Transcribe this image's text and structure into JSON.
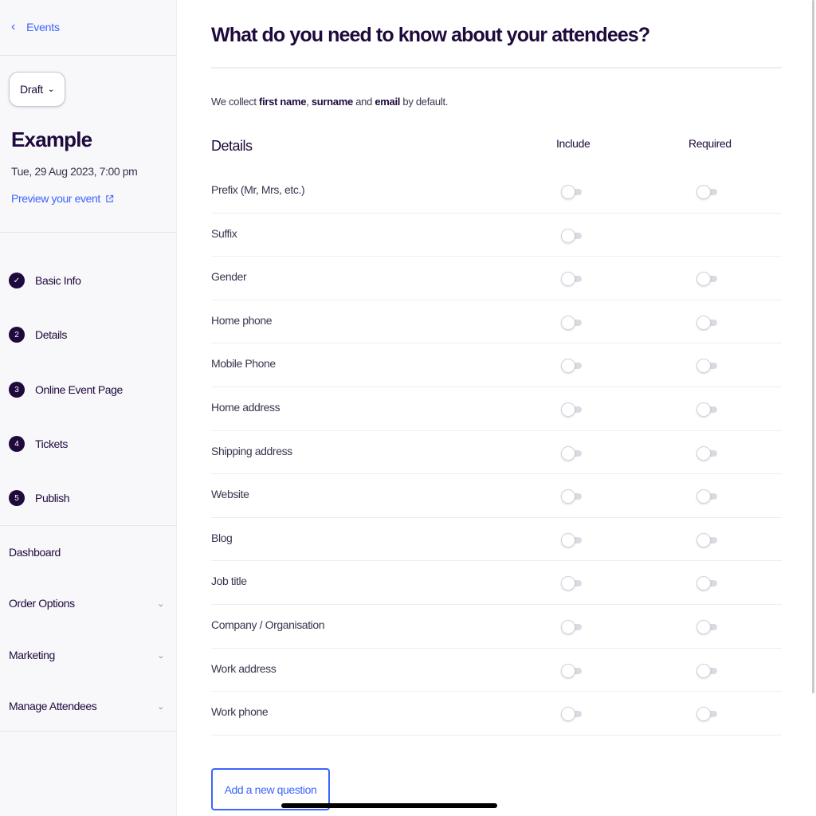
{
  "sidebar": {
    "back_label": "Events",
    "status": "Draft",
    "event_name": "Example",
    "event_date": "Tue, 29 Aug 2023, 7:00 pm",
    "preview_label": "Preview your event",
    "steps": [
      {
        "num": "✓",
        "label": "Basic Info",
        "state": "complete"
      },
      {
        "num": "2",
        "label": "Details",
        "state": "pending"
      },
      {
        "num": "3",
        "label": "Online Event Page",
        "state": "pending"
      },
      {
        "num": "4",
        "label": "Tickets",
        "state": "pending"
      },
      {
        "num": "5",
        "label": "Publish",
        "state": "pending"
      }
    ],
    "nav": [
      {
        "label": "Dashboard",
        "expandable": false
      },
      {
        "label": "Order Options",
        "expandable": true
      },
      {
        "label": "Marketing",
        "expandable": true
      },
      {
        "label": "Manage Attendees",
        "expandable": true
      }
    ]
  },
  "main": {
    "title": "What do you need to know about your attendees?",
    "intro": {
      "prefix": "We collect ",
      "first": "first name",
      "sep": ", ",
      "second": "surname",
      "mid": " and ",
      "third": "email",
      "suffix": " by default."
    },
    "details_header": "Details",
    "include_header": "Include",
    "required_header": "Required",
    "rows": [
      {
        "label": "Prefix (Mr, Mrs, etc.)",
        "include": false,
        "required": false,
        "has_required": true
      },
      {
        "label": "Suffix",
        "include": false,
        "required": false,
        "has_required": false
      },
      {
        "label": "Gender",
        "include": false,
        "required": false,
        "has_required": true
      },
      {
        "label": "Home phone",
        "include": false,
        "required": false,
        "has_required": true
      },
      {
        "label": "Mobile Phone",
        "include": false,
        "required": false,
        "has_required": true
      },
      {
        "label": "Home address",
        "include": false,
        "required": false,
        "has_required": true
      },
      {
        "label": "Shipping address",
        "include": false,
        "required": false,
        "has_required": true
      },
      {
        "label": "Website",
        "include": false,
        "required": false,
        "has_required": true
      },
      {
        "label": "Blog",
        "include": false,
        "required": false,
        "has_required": true
      },
      {
        "label": "Job title",
        "include": false,
        "required": false,
        "has_required": true
      },
      {
        "label": "Company / Organisation",
        "include": false,
        "required": false,
        "has_required": true
      },
      {
        "label": "Work address",
        "include": false,
        "required": false,
        "has_required": true
      },
      {
        "label": "Work phone",
        "include": false,
        "required": false,
        "has_required": true
      }
    ],
    "add_question_label": "Add a new question"
  },
  "colors": {
    "accent": "#3d64ff",
    "text_dark": "#1e0a3c",
    "sidebar_bg": "#f8f7fa"
  }
}
